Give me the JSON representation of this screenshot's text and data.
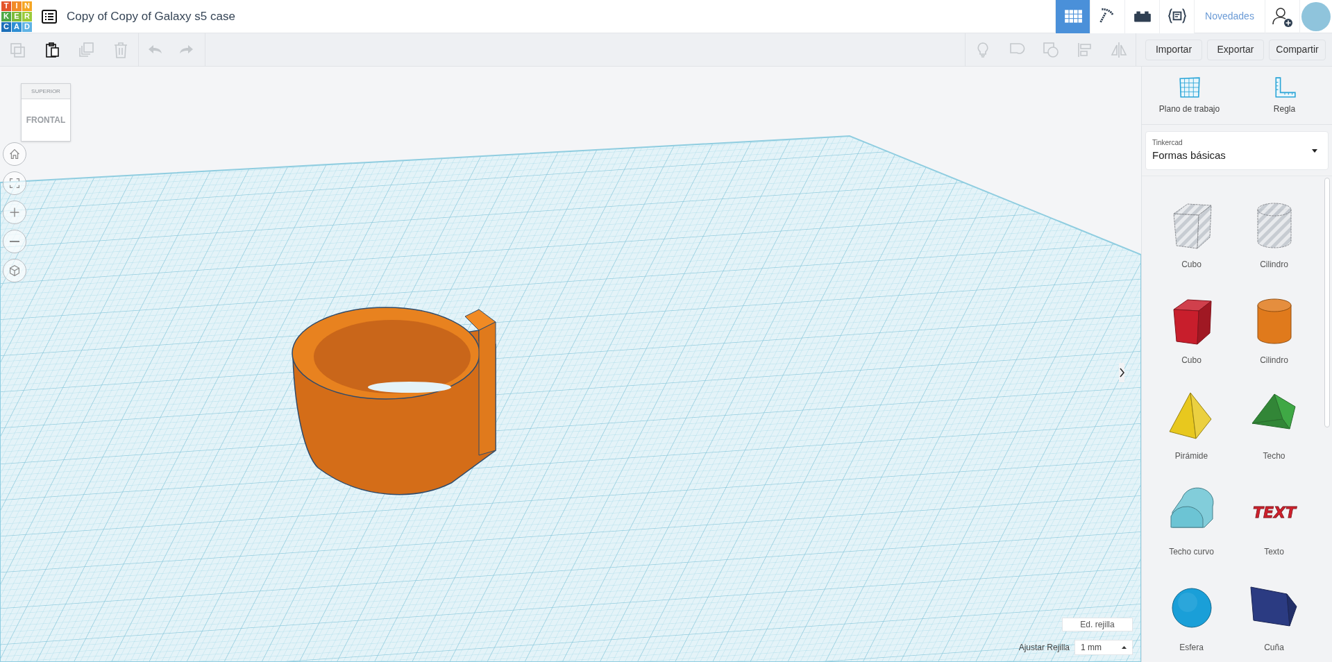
{
  "header": {
    "logo": [
      {
        "letter": "T",
        "color": "#e4542b"
      },
      {
        "letter": "I",
        "color": "#f28c28"
      },
      {
        "letter": "N",
        "color": "#f5a623"
      },
      {
        "letter": "K",
        "color": "#4fa845"
      },
      {
        "letter": "E",
        "color": "#7dbb3a"
      },
      {
        "letter": "R",
        "color": "#9ccb3b"
      },
      {
        "letter": "C",
        "color": "#1c6fb8"
      },
      {
        "letter": "A",
        "color": "#2e8ed3"
      },
      {
        "letter": "D",
        "color": "#5fb3e4"
      }
    ],
    "title": "Copy of Copy of Galaxy s5 case",
    "nav": [
      {
        "kind": "grid",
        "selected": true
      },
      {
        "kind": "pickaxe",
        "selected": false
      },
      {
        "kind": "brick",
        "selected": false
      },
      {
        "kind": "code",
        "selected": false
      }
    ],
    "news_link": "Novedades"
  },
  "toolbar": {
    "edit_tools": [
      {
        "kind": "copy",
        "disabled": true
      },
      {
        "kind": "paste",
        "disabled": false
      },
      {
        "kind": "duplicate",
        "disabled": true
      },
      {
        "kind": "delete",
        "disabled": true
      }
    ],
    "history_tools": [
      {
        "kind": "undo",
        "disabled": true
      },
      {
        "kind": "redo",
        "disabled": true
      }
    ],
    "shape_tools": [
      {
        "kind": "bulb",
        "disabled": true
      },
      {
        "kind": "group",
        "disabled": true
      },
      {
        "kind": "union",
        "disabled": true
      },
      {
        "kind": "align",
        "disabled": true
      },
      {
        "kind": "mirror",
        "disabled": true
      }
    ],
    "buttons": [
      "Importar",
      "Exportar",
      "Compartir"
    ]
  },
  "view_cube": {
    "top": "SUPERIOR",
    "front": "FRONTAL"
  },
  "view_controls": [
    {
      "kind": "home"
    },
    {
      "kind": "fit"
    },
    {
      "kind": "zoom_in"
    },
    {
      "kind": "zoom_out"
    },
    {
      "kind": "perspective"
    }
  ],
  "grid_controls": {
    "edit_button": "Ed. rejilla",
    "snap_label": "Ajustar Rejilla",
    "snap_value": "1 mm"
  },
  "panel": {
    "tools": [
      {
        "kind": "workplane",
        "label": "Plano de trabajo"
      },
      {
        "kind": "ruler",
        "label": "Regla"
      }
    ],
    "library": {
      "caption": "Tinkercad",
      "value": "Formas básicas"
    },
    "shapes": [
      {
        "kind": "box",
        "label": "Cubo",
        "color": "#c3c8cf",
        "hole": true
      },
      {
        "kind": "cylinder",
        "label": "Cilindro",
        "color": "#c3c8cf",
        "hole": true
      },
      {
        "kind": "box",
        "label": "Cubo",
        "color": "#c81e2c",
        "hole": false
      },
      {
        "kind": "cylinder",
        "label": "Cilindro",
        "color": "#e07a1c",
        "hole": false
      },
      {
        "kind": "pyramid",
        "label": "Pirámide",
        "color": "#e8c81e",
        "hole": false
      },
      {
        "kind": "roof",
        "label": "Techo",
        "color": "#3fa845",
        "hole": false
      },
      {
        "kind": "round_roof",
        "label": "Techo curvo",
        "color": "#6cc4d4",
        "hole": false
      },
      {
        "kind": "text",
        "label": "Texto",
        "color": "#d0202c",
        "hole": false
      },
      {
        "kind": "sphere",
        "label": "Esfera",
        "color": "#1a9fd8",
        "hole": false
      },
      {
        "kind": "wedge",
        "label": "Cuña",
        "color": "#2b3b82",
        "hole": false
      }
    ],
    "text_shape_preview": "TEXT"
  }
}
